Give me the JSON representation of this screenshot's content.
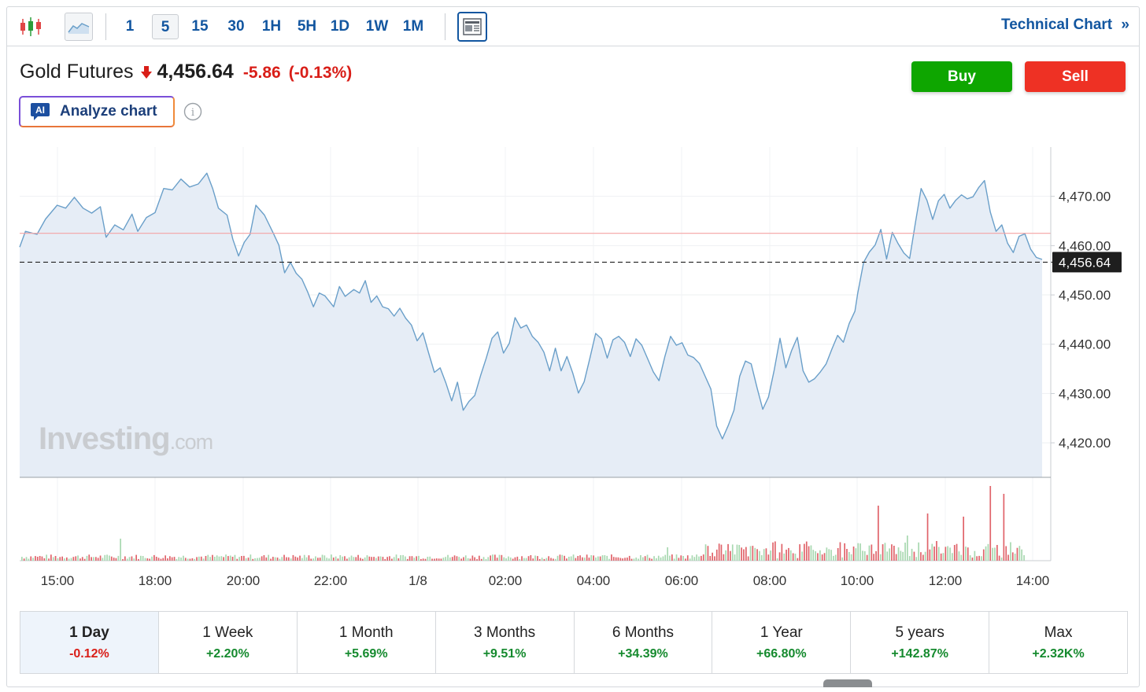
{
  "toolbar": {
    "timeframes": [
      "1",
      "5",
      "15",
      "30",
      "1H",
      "5H",
      "1D",
      "1W",
      "1M"
    ],
    "active_timeframe": "5",
    "technical_chart_label": "Technical Chart",
    "technical_chart_chevron": "»",
    "icons": [
      "candlestick-icon",
      "area-chart-icon",
      "news-layout-icon"
    ]
  },
  "instrument": {
    "name": "Gold Futures",
    "price": "4,456.64",
    "change": "-5.86",
    "change_pct": "(-0.13%)",
    "direction": "down"
  },
  "actions": {
    "buy_label": "Buy",
    "sell_label": "Sell"
  },
  "analyze": {
    "badge": "AI",
    "label": "Analyze chart",
    "info_glyph": "i"
  },
  "watermark": {
    "brand": "Investing",
    "suffix": ".com"
  },
  "colors": {
    "accent": "#1256a0",
    "line": "#6a9fc9",
    "area_fill": "#e6edf6",
    "up": "#158a2e",
    "down": "#d91e18",
    "buy": "#0ea600",
    "sell": "#ee3124",
    "reference_line": "#f4a3a3",
    "volume_up": "#a8d8b0",
    "volume_down": "#e0636a"
  },
  "chart_data": {
    "type": "area",
    "ylim": [
      4413,
      4480
    ],
    "yticks": [
      4420,
      4430,
      4440,
      4450,
      4460,
      4470
    ],
    "ytick_labels": [
      "4,420.00",
      "4,430.00",
      "4,440.00",
      "4,450.00",
      "4,460.00",
      "4,470.00"
    ],
    "current_price": 4456.64,
    "current_price_label": "4,456.64",
    "previous_close": 4462.5,
    "x_ticks": [
      {
        "label": "15:00",
        "h": 0.7
      },
      {
        "label": "18:00",
        "h": 3.7
      },
      {
        "label": "20:00",
        "h": 5.7
      },
      {
        "label": "22:00",
        "h": 7.7
      },
      {
        "label": "1/8",
        "h": 9.7
      },
      {
        "label": "02:00",
        "h": 11.7
      },
      {
        "label": "04:00",
        "h": 13.7
      },
      {
        "label": "06:00",
        "h": 15.7
      },
      {
        "label": "08:00",
        "h": 17.7
      },
      {
        "label": "10:00",
        "h": 19.7
      },
      {
        "label": "12:00",
        "h": 21.7
      },
      {
        "label": "14:00",
        "h": 23.7
      }
    ],
    "x_range_hours": [
      0,
      23.9
    ],
    "series": [
      {
        "points": [
          [
            0.0,
            4459.7
          ],
          [
            0.2,
            4462.9
          ],
          [
            0.6,
            4462.3
          ],
          [
            0.9,
            4465.4
          ],
          [
            1.3,
            4468.2
          ],
          [
            1.6,
            4467.6
          ],
          [
            1.9,
            4469.8
          ],
          [
            2.2,
            4467.6
          ],
          [
            2.5,
            4466.6
          ],
          [
            2.8,
            4467.9
          ],
          [
            3.0,
            4461.7
          ],
          [
            3.3,
            4464.2
          ],
          [
            3.6,
            4463.2
          ],
          [
            3.9,
            4466.4
          ],
          [
            4.1,
            4462.9
          ],
          [
            4.4,
            4465.7
          ],
          [
            4.7,
            4466.7
          ],
          [
            5.0,
            4471.6
          ],
          [
            5.3,
            4471.3
          ],
          [
            5.6,
            4473.5
          ],
          [
            5.9,
            4471.9
          ],
          [
            6.2,
            4472.5
          ],
          [
            6.5,
            4474.7
          ],
          [
            6.7,
            4471.6
          ],
          [
            6.9,
            4467.6
          ],
          [
            7.2,
            4466.2
          ],
          [
            7.4,
            4461.3
          ],
          [
            7.6,
            4457.9
          ],
          [
            7.8,
            4460.7
          ],
          [
            8.0,
            4462.3
          ],
          [
            8.2,
            4468.2
          ],
          [
            8.5,
            4466.2
          ],
          [
            8.8,
            4462.6
          ],
          [
            9.0,
            4460.1
          ],
          [
            9.2,
            4454.5
          ],
          [
            9.4,
            4456.6
          ],
          [
            9.6,
            4454.4
          ],
          [
            9.8,
            4453.2
          ],
          [
            10.0,
            4450.6
          ],
          [
            10.2,
            4447.6
          ],
          [
            10.4,
            4450.4
          ],
          [
            10.6,
            4449.8
          ],
          [
            10.9,
            4447.6
          ],
          [
            11.1,
            4451.7
          ],
          [
            11.3,
            4449.7
          ],
          [
            11.6,
            4451.1
          ],
          [
            11.8,
            4450.4
          ],
          [
            12.0,
            4452.9
          ],
          [
            12.2,
            4448.5
          ],
          [
            12.4,
            4449.8
          ],
          [
            12.6,
            4447.6
          ],
          [
            12.8,
            4447.2
          ],
          [
            13.0,
            4445.7
          ],
          [
            13.2,
            4447.3
          ],
          [
            13.4,
            4445.3
          ],
          [
            13.6,
            4443.9
          ],
          [
            13.8,
            4440.7
          ],
          [
            14.0,
            4442.3
          ],
          [
            14.2,
            4438.2
          ],
          [
            14.4,
            4434.3
          ],
          [
            14.6,
            4435.2
          ],
          [
            14.8,
            4432.1
          ],
          [
            15.0,
            4428.5
          ],
          [
            15.2,
            4432.3
          ],
          [
            15.4,
            4426.6
          ],
          [
            15.6,
            4428.4
          ],
          [
            15.8,
            4429.6
          ],
          [
            16.0,
            4433.6
          ],
          [
            16.2,
            4437.2
          ],
          [
            16.4,
            4441.2
          ],
          [
            16.6,
            4442.5
          ],
          [
            16.8,
            4438.2
          ],
          [
            17.0,
            4440.2
          ],
          [
            17.2,
            4445.4
          ],
          [
            17.4,
            4443.3
          ],
          [
            17.6,
            4443.9
          ],
          [
            17.8,
            4441.6
          ],
          [
            18.0,
            4440.4
          ],
          [
            18.2,
            4438.4
          ],
          [
            18.4,
            4434.6
          ],
          [
            18.6,
            4439.2
          ],
          [
            18.8,
            4434.6
          ],
          [
            19.0,
            4437.5
          ],
          [
            19.2,
            4434.2
          ],
          [
            19.4,
            4430.1
          ],
          [
            19.6,
            4432.4
          ],
          [
            19.8,
            4437.2
          ],
          [
            20.0,
            4442.2
          ],
          [
            20.2,
            4441.1
          ],
          [
            20.4,
            4437.2
          ],
          [
            20.6,
            4440.9
          ],
          [
            20.8,
            4441.6
          ],
          [
            21.0,
            4440.4
          ],
          [
            21.2,
            4437.5
          ],
          [
            21.4,
            4441.1
          ],
          [
            21.6,
            4439.8
          ],
          [
            21.8,
            4437.1
          ],
          [
            22.0,
            4434.4
          ],
          [
            22.2,
            4432.6
          ],
          [
            22.4,
            4437.5
          ],
          [
            22.6,
            4441.6
          ],
          [
            22.8,
            4439.8
          ],
          [
            23.0,
            4440.3
          ],
          [
            23.2,
            4437.8
          ],
          [
            23.4,
            4437.3
          ],
          [
            23.6,
            4436.1
          ],
          [
            23.8,
            4433.5
          ],
          [
            24.0,
            4430.9
          ],
          [
            24.2,
            4423.4
          ],
          [
            24.4,
            4420.8
          ],
          [
            24.6,
            4423.5
          ],
          [
            24.8,
            4426.6
          ],
          [
            25.0,
            4433.5
          ],
          [
            25.2,
            4436.6
          ],
          [
            25.4,
            4436.0
          ],
          [
            25.6,
            4431.2
          ],
          [
            25.8,
            4426.8
          ],
          [
            26.0,
            4429.3
          ],
          [
            26.2,
            4434.8
          ],
          [
            26.4,
            4441.2
          ],
          [
            26.6,
            4435.2
          ],
          [
            26.8,
            4438.7
          ],
          [
            27.0,
            4441.4
          ],
          [
            27.2,
            4434.6
          ],
          [
            27.4,
            4432.3
          ],
          [
            27.6,
            4433.0
          ],
          [
            27.8,
            4434.4
          ],
          [
            28.0,
            4436.0
          ],
          [
            28.2,
            4439.0
          ],
          [
            28.4,
            4441.8
          ],
          [
            28.6,
            4440.4
          ],
          [
            28.8,
            4444.2
          ],
          [
            29.0,
            4446.7
          ],
          [
            29.1,
            4450.4
          ],
          [
            29.3,
            4456.6
          ],
          [
            29.5,
            4458.7
          ],
          [
            29.7,
            4460.1
          ],
          [
            29.9,
            4463.3
          ],
          [
            30.1,
            4457.3
          ],
          [
            30.3,
            4462.7
          ],
          [
            30.5,
            4460.4
          ],
          [
            30.7,
            4458.5
          ],
          [
            30.9,
            4457.4
          ],
          [
            31.1,
            4464.6
          ],
          [
            31.3,
            4471.6
          ],
          [
            31.5,
            4469.2
          ],
          [
            31.7,
            4465.3
          ],
          [
            31.9,
            4469.1
          ],
          [
            32.1,
            4470.4
          ],
          [
            32.3,
            4467.6
          ],
          [
            32.5,
            4469.2
          ],
          [
            32.7,
            4470.3
          ],
          [
            32.9,
            4469.5
          ],
          [
            33.1,
            4469.9
          ],
          [
            33.3,
            4471.8
          ],
          [
            33.5,
            4473.2
          ],
          [
            33.7,
            4466.8
          ],
          [
            33.9,
            4462.9
          ],
          [
            34.1,
            4464.2
          ],
          [
            34.3,
            4460.5
          ],
          [
            34.5,
            4458.6
          ],
          [
            34.7,
            4461.9
          ],
          [
            34.9,
            4462.4
          ],
          [
            35.1,
            4459.3
          ],
          [
            35.3,
            4457.6
          ],
          [
            35.5,
            4457.2
          ]
        ]
      }
    ]
  },
  "volume_data": {
    "type": "bar",
    "note": "relative volume bars per 5-minute interval",
    "y_max": 100
  },
  "periods": [
    {
      "label": "1 Day",
      "change": "-0.12%",
      "dir": "down",
      "active": true
    },
    {
      "label": "1 Week",
      "change": "+2.20%",
      "dir": "up"
    },
    {
      "label": "1 Month",
      "change": "+5.69%",
      "dir": "up"
    },
    {
      "label": "3 Months",
      "change": "+9.51%",
      "dir": "up"
    },
    {
      "label": "6 Months",
      "change": "+34.39%",
      "dir": "up"
    },
    {
      "label": "1 Year",
      "change": "+66.80%",
      "dir": "up"
    },
    {
      "label": "5 years",
      "change": "+142.87%",
      "dir": "up"
    },
    {
      "label": "Max",
      "change": "+2.32K%",
      "dir": "up"
    }
  ]
}
